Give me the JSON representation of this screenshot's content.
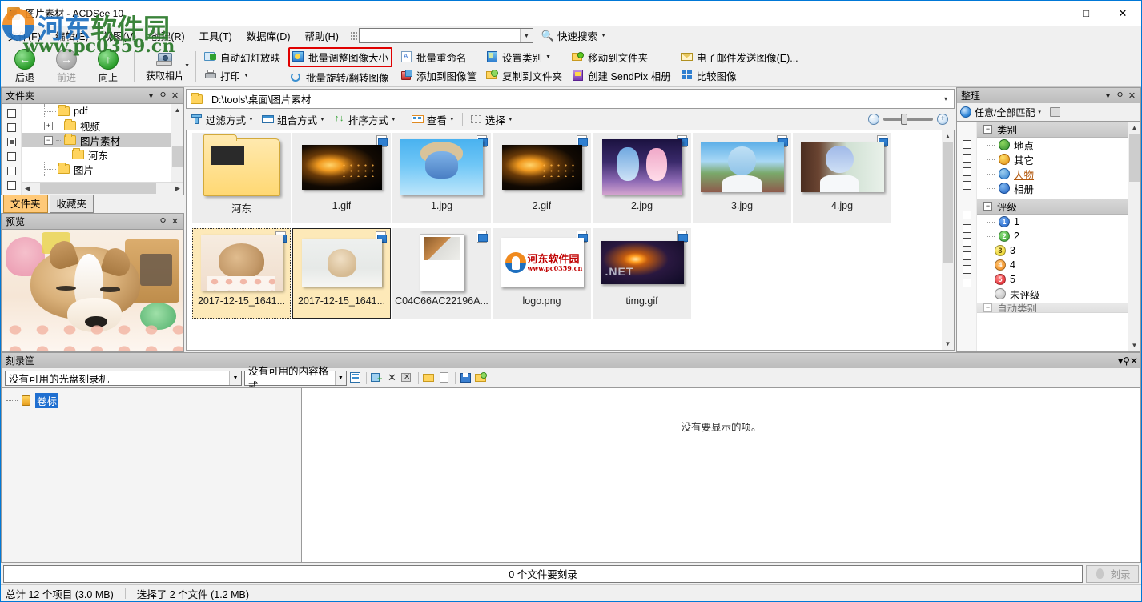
{
  "window": {
    "title": "图片素材 - ACDSee 10",
    "minimize": "—",
    "maximize": "□",
    "close": "✕"
  },
  "watermark": {
    "line1_blue": "河东",
    "line1_green": "软件园",
    "line2": "www.pc0359.cn"
  },
  "menu": {
    "items": [
      {
        "label": "文件(F)",
        "key": "F"
      },
      {
        "label": "编辑(E)",
        "key": "E"
      },
      {
        "label": "视图(V)",
        "key": "V"
      },
      {
        "label": "创建(R)",
        "key": "R"
      },
      {
        "label": "工具(T)",
        "key": "T"
      },
      {
        "label": "数据库(D)",
        "key": "D"
      },
      {
        "label": "帮助(H)",
        "key": "H"
      }
    ],
    "search_value": "",
    "search_placeholder": "",
    "quick_search_label": "快速搜索"
  },
  "toolbar": {
    "nav": [
      {
        "label": "后退",
        "icon": "back-arrow-icon",
        "disabled": false
      },
      {
        "label": "前进",
        "icon": "forward-arrow-icon",
        "disabled": true
      },
      {
        "label": "向上",
        "icon": "up-arrow-icon",
        "disabled": false
      }
    ],
    "acquire_label": "获取相片",
    "groups": [
      {
        "top": "自动幻灯放映",
        "bottom": "打印",
        "top_icon": "slideshow-icon",
        "bottom_icon": "printer-icon",
        "bottom_has_caret": true
      },
      {
        "top": "批量调整图像大小",
        "bottom": "批量旋转/翻转图像",
        "top_icon": "resize-icon",
        "bottom_icon": "rotate-icon",
        "top_highlighted": true
      },
      {
        "top": "批量重命名",
        "bottom": "添加到图像筐",
        "top_icon": "rename-icon",
        "bottom_icon": "basket-icon"
      },
      {
        "top": "设置类别",
        "bottom": "复制到文件夹",
        "top_icon": "category-icon",
        "bottom_icon": "copy-folder-icon",
        "top_has_caret": true
      },
      {
        "top": "移动到文件夹",
        "bottom": "创建 SendPix 相册",
        "top_icon": "move-folder-icon",
        "bottom_icon": "sendpix-icon"
      },
      {
        "top": "电子邮件发送图像(E)...",
        "bottom": "比较图像",
        "top_icon": "email-icon",
        "bottom_icon": "compare-icon"
      }
    ],
    "highlight_color": "#e00000"
  },
  "folders_panel": {
    "title": "文件夹",
    "buttons": {
      "dropdown": "▾",
      "pin": "⚲",
      "close": "✕"
    },
    "tree": [
      {
        "label": "pdf",
        "depth": 2,
        "expander": "",
        "selected": false,
        "checkbox": "empty"
      },
      {
        "label": "视频",
        "depth": 2,
        "expander": "+",
        "selected": false,
        "checkbox": "empty"
      },
      {
        "label": "图片素材",
        "depth": 2,
        "expander": "−",
        "selected": true,
        "checkbox": "partial"
      },
      {
        "label": "河东",
        "depth": 3,
        "expander": "",
        "selected": false,
        "checkbox": "empty"
      },
      {
        "label": "图片",
        "depth": 2,
        "expander": "",
        "selected": false,
        "checkbox": "empty"
      }
    ],
    "tabs": [
      {
        "label": "文件夹",
        "active": true
      },
      {
        "label": "收藏夹",
        "active": false
      }
    ]
  },
  "preview_panel": {
    "title": "预览",
    "buttons": {
      "pin": "⚲",
      "close": "✕"
    },
    "image_alt": "sleeping-corgi-puppy"
  },
  "address_bar": {
    "path": "D:\\tools\\桌面\\图片素材",
    "dropdown": "▾"
  },
  "browse_bar": {
    "items": [
      {
        "label": "过滤方式",
        "icon": "filter-icon",
        "caret": true
      },
      {
        "label": "组合方式",
        "icon": "group-icon",
        "caret": true
      },
      {
        "label": "排序方式",
        "icon": "sort-icon",
        "caret": true
      },
      {
        "label": "查看",
        "icon": "view-icon",
        "caret": true
      },
      {
        "label": "选择",
        "icon": "select-icon",
        "caret": true
      }
    ],
    "zoom_out": "−",
    "zoom_in": "+"
  },
  "thumbnails": [
    {
      "name": "河东",
      "kind": "folder",
      "art": "folder",
      "badge": false,
      "selected": false,
      "focus": false
    },
    {
      "name": "1.gif",
      "kind": "image",
      "art": "art-gif",
      "badge": true,
      "selected": false,
      "focus": false
    },
    {
      "name": "1.jpg",
      "kind": "image",
      "art": "art-rem1",
      "badge": true,
      "selected": false,
      "focus": false
    },
    {
      "name": "2.gif",
      "kind": "image",
      "art": "art-gif",
      "badge": true,
      "selected": false,
      "focus": false
    },
    {
      "name": "2.jpg",
      "kind": "image",
      "art": "art-rem2",
      "badge": true,
      "selected": false,
      "focus": false
    },
    {
      "name": "3.jpg",
      "kind": "image",
      "art": "art-rem3",
      "badge": true,
      "selected": false,
      "focus": false
    },
    {
      "name": "4.jpg",
      "kind": "image",
      "art": "art-rem4",
      "badge": true,
      "selected": false,
      "focus": false
    },
    {
      "name": "2017-12-15_1641...",
      "kind": "image",
      "art": "art-dog1",
      "badge": true,
      "selected": true,
      "focus": false,
      "dashed": true
    },
    {
      "name": "2017-12-15_1641...",
      "kind": "image",
      "art": "art-dog2",
      "badge": true,
      "selected": true,
      "focus": true
    },
    {
      "name": "C04C66AC22196A...",
      "kind": "image",
      "art": "art-doc",
      "badge": true,
      "selected": false,
      "focus": false
    },
    {
      "name": "logo.png",
      "kind": "image",
      "art": "art-logo",
      "badge": true,
      "selected": false,
      "focus": false
    },
    {
      "name": "timg.gif",
      "kind": "image",
      "art": "art-timg",
      "badge": true,
      "selected": false,
      "focus": false
    }
  ],
  "organize_panel": {
    "title": "整理",
    "buttons": {
      "dropdown": "▾",
      "pin": "⚲",
      "close": "✕"
    },
    "match_label": "任意/全部匹配",
    "match_caret": "▾",
    "groups": [
      {
        "title": "类别",
        "expander": "−",
        "items": [
          {
            "label": "地点",
            "icon": "globe-icon",
            "color": "#2f9e44",
            "link": false
          },
          {
            "label": "其它",
            "icon": "flower-icon",
            "color": "#f0a020",
            "link": false
          },
          {
            "label": "人物",
            "icon": "people-icon",
            "color": "#3b7dd8",
            "link": true
          },
          {
            "label": "相册",
            "icon": "album-icon",
            "color": "#2f6fd0",
            "link": false
          }
        ]
      },
      {
        "title": "评级",
        "expander": "−",
        "items": [
          {
            "label": "1",
            "ball": "1",
            "color": "#1f63c8"
          },
          {
            "label": "2",
            "ball": "2",
            "color": "#33a02c"
          },
          {
            "label": "3",
            "ball": "3",
            "color": "#e8d020"
          },
          {
            "label": "4",
            "ball": "4",
            "color": "#f08a1e"
          },
          {
            "label": "5",
            "ball": "5",
            "color": "#e01b24"
          },
          {
            "label": "未评级",
            "ball": "",
            "color": "#c0c0c0"
          }
        ]
      },
      {
        "title": "自动类别",
        "expander": "−",
        "items": []
      }
    ]
  },
  "burn_panel": {
    "title": "刻录筐",
    "buttons": {
      "dropdown": "▾",
      "pin": "⚲",
      "close": "✕"
    },
    "drive_select": "没有可用的光盘刻录机",
    "format_select": "没有可用的内容格式",
    "tools": [
      {
        "name": "properties-icon"
      },
      {
        "name": "add-files-icon"
      },
      {
        "name": "remove-icon"
      },
      {
        "name": "remove-all-icon"
      },
      {
        "name": "open-folder-icon"
      },
      {
        "name": "new-file-icon"
      },
      {
        "name": "save-icon"
      },
      {
        "name": "load-icon"
      }
    ],
    "volume_label": "卷标",
    "empty_message": "没有要显示的项。",
    "files_to_burn": "0 个文件要刻录",
    "burn_button": "刻录"
  },
  "status_bar": {
    "total": "总计 12 个项目 (3.0 MB)",
    "selected": "选择了 2 个文件 (1.2 MB)"
  }
}
